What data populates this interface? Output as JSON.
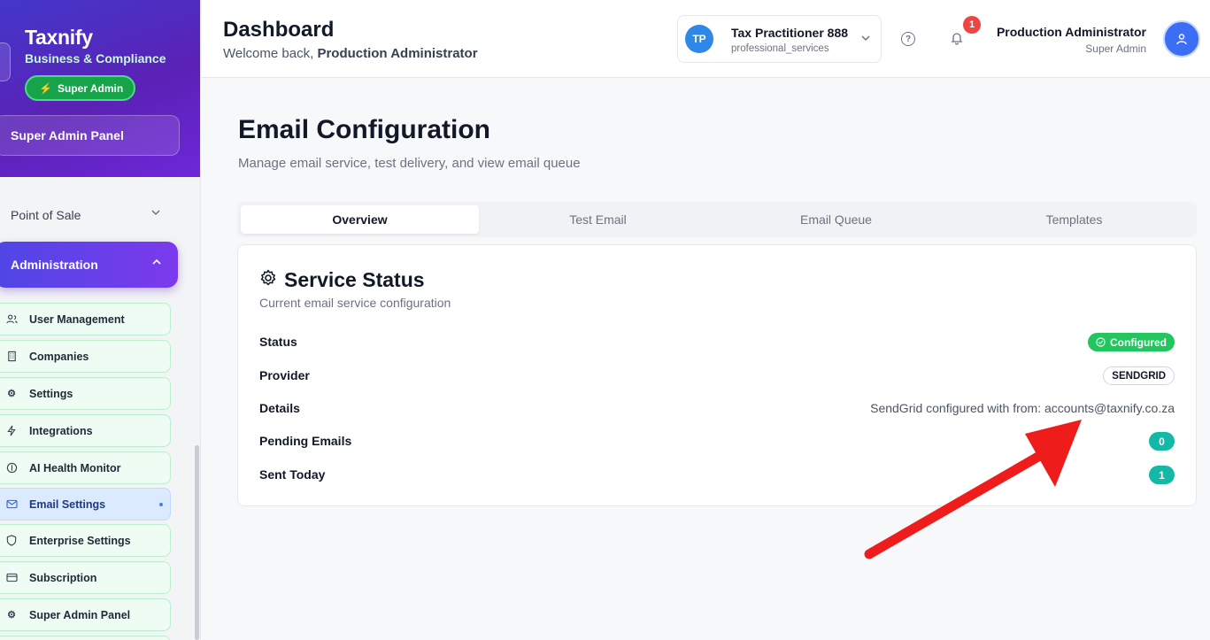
{
  "sidebar": {
    "brand": {
      "name": "Taxnify",
      "subtitle": "Business & Compliance",
      "badge": "Super Admin"
    },
    "panel_button": "Super Admin Panel",
    "groups": [
      {
        "label": "Point of Sale",
        "expanded": false
      },
      {
        "label": "Administration",
        "expanded": true
      }
    ],
    "items": [
      {
        "label": "User Management",
        "icon": "users-icon"
      },
      {
        "label": "Companies",
        "icon": "building-icon"
      },
      {
        "label": "Settings",
        "icon": "gear-icon"
      },
      {
        "label": "Integrations",
        "icon": "bolt-icon"
      },
      {
        "label": "AI Health Monitor",
        "icon": "health-icon"
      },
      {
        "label": "Email Settings",
        "icon": "mail-icon",
        "active": true
      },
      {
        "label": "Enterprise Settings",
        "icon": "shield-icon"
      },
      {
        "label": "Subscription",
        "icon": "card-icon"
      },
      {
        "label": "Super Admin Panel",
        "icon": "gear-icon"
      }
    ]
  },
  "header": {
    "title": "Dashboard",
    "welcome_prefix": "Welcome back,",
    "welcome_name": "Production Administrator",
    "org": {
      "initials": "TP",
      "name": "Tax Practitioner 888",
      "type": "professional_services"
    },
    "notifications": "1",
    "user": {
      "name": "Production Administrator",
      "role": "Super Admin"
    }
  },
  "main": {
    "title": "Email Configuration",
    "subtitle": "Manage email service, test delivery, and view email queue",
    "tabs": [
      {
        "label": "Overview",
        "active": true
      },
      {
        "label": "Test Email",
        "active": false
      },
      {
        "label": "Email Queue",
        "active": false
      },
      {
        "label": "Templates",
        "active": false
      }
    ],
    "card": {
      "title": "Service Status",
      "subtitle": "Current email service configuration",
      "rows": {
        "status": {
          "label": "Status",
          "value": "Configured"
        },
        "provider": {
          "label": "Provider",
          "value": "SENDGRID"
        },
        "details": {
          "label": "Details",
          "value": "SendGrid configured with from: accounts@taxnify.co.za"
        },
        "pending": {
          "label": "Pending Emails",
          "value": "0"
        },
        "sent": {
          "label": "Sent Today",
          "value": "1"
        }
      }
    }
  },
  "colors": {
    "primary_gradient_start": "#4338ca",
    "primary_gradient_end": "#6d28d9",
    "success": "#22c55e",
    "teal": "#14b8a6",
    "annotation_arrow": "#ef1c1c"
  },
  "annotation": {
    "type": "arrow",
    "points_to": "details-value"
  }
}
